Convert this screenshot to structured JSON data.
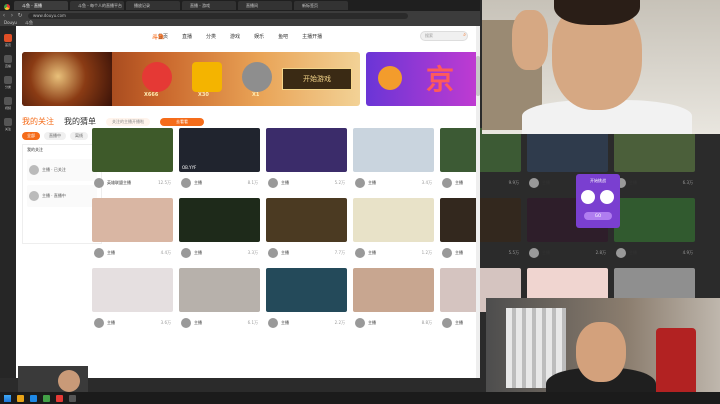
{
  "browser": {
    "tabs": [
      {
        "label": "斗鱼 - 直播"
      },
      {
        "label": "斗鱼 - 每个人的直播平台"
      },
      {
        "label": "播放记录"
      },
      {
        "label": "直播 - 游戏"
      },
      {
        "label": "直播间"
      },
      {
        "label": "新标签页"
      }
    ],
    "url": "www.douyu.com",
    "bookmarks": [
      "Douyu",
      "斗鱼"
    ]
  },
  "leftbar": {
    "items": [
      {
        "label": "首页"
      },
      {
        "label": "直播"
      },
      {
        "label": "分类"
      },
      {
        "label": "视频"
      },
      {
        "label": "关注"
      }
    ]
  },
  "topnav": {
    "logo": "斗鱼",
    "items": [
      "首页",
      "直播",
      "分类",
      "游戏",
      "娱乐",
      "鱼吧",
      "主播开播"
    ],
    "search_placeholder": "搜索"
  },
  "banner": {
    "prizes": [
      {
        "label": "X666",
        "color": "#e53935"
      },
      {
        "label": "X30",
        "color": "#f4b400"
      },
      {
        "label": "X1",
        "color": "#8e8e8e"
      }
    ],
    "button_label": "开始游戏",
    "side_text": "京"
  },
  "section": {
    "title": "我的关注",
    "title2": "我的猜单",
    "notice": "关注的主播开播啦",
    "pill": "去看看",
    "chips": [
      {
        "label": "全部",
        "on": true
      },
      {
        "label": "直播中",
        "on": false
      },
      {
        "label": "离线",
        "on": false
      }
    ]
  },
  "leftpanel": {
    "title": "我的关注",
    "cards": [
      {
        "text": "主播 · 已关注"
      },
      {
        "text": "主播 · 直播中"
      }
    ]
  },
  "rooms": [
    {
      "name": "英雄联盟主播",
      "count": "12.5万",
      "lab": "",
      "color": "#3e5a2a"
    },
    {
      "name": "主播",
      "count": "8.1万",
      "lab": "OB.YYF",
      "color": "#20242e"
    },
    {
      "name": "主播",
      "count": "5.2万",
      "lab": "",
      "color": "#3b2c6a"
    },
    {
      "name": "主播",
      "count": "3.4万",
      "lab": "",
      "color": "#c9d4de"
    },
    {
      "name": "主播",
      "count": "9.9万",
      "lab": "",
      "color": "#3c5a34"
    },
    {
      "name": "主播",
      "count": "2.1万",
      "lab": "",
      "color": "#2f3b4c"
    },
    {
      "name": "主播",
      "count": "6.3万",
      "lab": "",
      "color": "#4b5f3a"
    },
    {
      "name": "主播",
      "count": "4.4万",
      "lab": "",
      "color": "#d9b6a3"
    },
    {
      "name": "主播",
      "count": "3.3万",
      "lab": "",
      "color": "#1e2a1a"
    },
    {
      "name": "主播",
      "count": "7.7万",
      "lab": "",
      "color": "#4b3a22"
    },
    {
      "name": "主播",
      "count": "1.2万",
      "lab": "",
      "color": "#e8e2c8"
    },
    {
      "name": "主播",
      "count": "5.5万",
      "lab": "",
      "color": "#33281e"
    },
    {
      "name": "主播",
      "count": "2.8万",
      "lab": "",
      "color": "#2e1e2a"
    },
    {
      "name": "主播",
      "count": "4.9万",
      "lab": "",
      "color": "#315a2f"
    },
    {
      "name": "主播",
      "count": "3.6万",
      "lab": "",
      "color": "#e5dfe0"
    },
    {
      "name": "主播",
      "count": "6.1万",
      "lab": "",
      "color": "#b7b1ab"
    },
    {
      "name": "主播",
      "count": "2.2万",
      "lab": "",
      "color": "#244a5a"
    },
    {
      "name": "主播",
      "count": "8.8万",
      "lab": "",
      "color": "#c8a690"
    },
    {
      "name": "主播",
      "count": "3.1万",
      "lab": "",
      "color": "#d5c4c0"
    },
    {
      "name": "主播",
      "count": "4.0万",
      "lab": "",
      "color": "#f0d5d0"
    },
    {
      "name": "主播",
      "count": "1.9万",
      "lab": "",
      "color": "#8f8f8f"
    }
  ],
  "popup": {
    "title": "开始挑战",
    "button": "GO"
  }
}
